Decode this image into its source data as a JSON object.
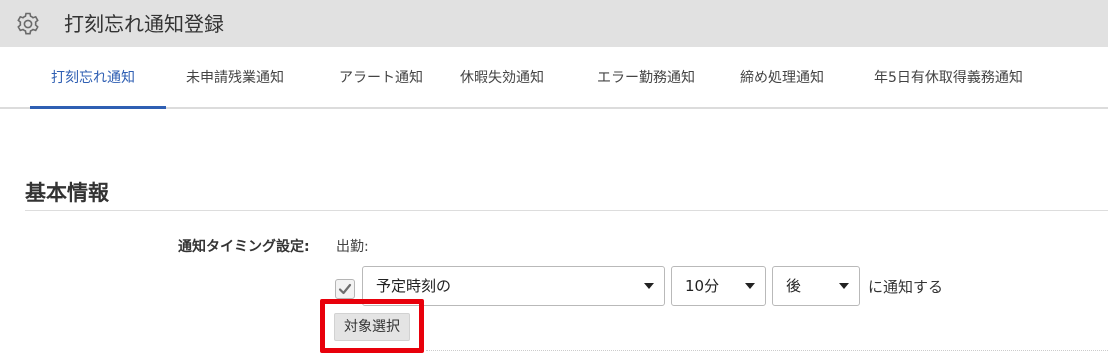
{
  "header": {
    "title": "打刻忘れ通知登録",
    "icon": "gear-icon"
  },
  "tabs": [
    {
      "label": "打刻忘れ通知",
      "active": true
    },
    {
      "label": "未申請残業通知",
      "active": false
    },
    {
      "label": "アラート通知",
      "active": false
    },
    {
      "label": "休暇失効通知",
      "active": false
    },
    {
      "label": "エラー勤務通知",
      "active": false
    },
    {
      "label": "締め処理通知",
      "active": false
    },
    {
      "label": "年5日有休取得義務通知",
      "active": false
    }
  ],
  "section": {
    "title": "基本情報"
  },
  "form": {
    "timing_label": "通知タイミング設定:",
    "attendance_label": "出勤:",
    "enabled": true,
    "timing_select": "予定時刻の",
    "minutes_select": "10分",
    "direction_select": "後",
    "suffix": "に通知する",
    "target_button": "対象選択"
  },
  "colors": {
    "header_bg": "#e1e1e1",
    "active_tab": "#2f5fb3",
    "highlight_border": "#e8000b"
  }
}
